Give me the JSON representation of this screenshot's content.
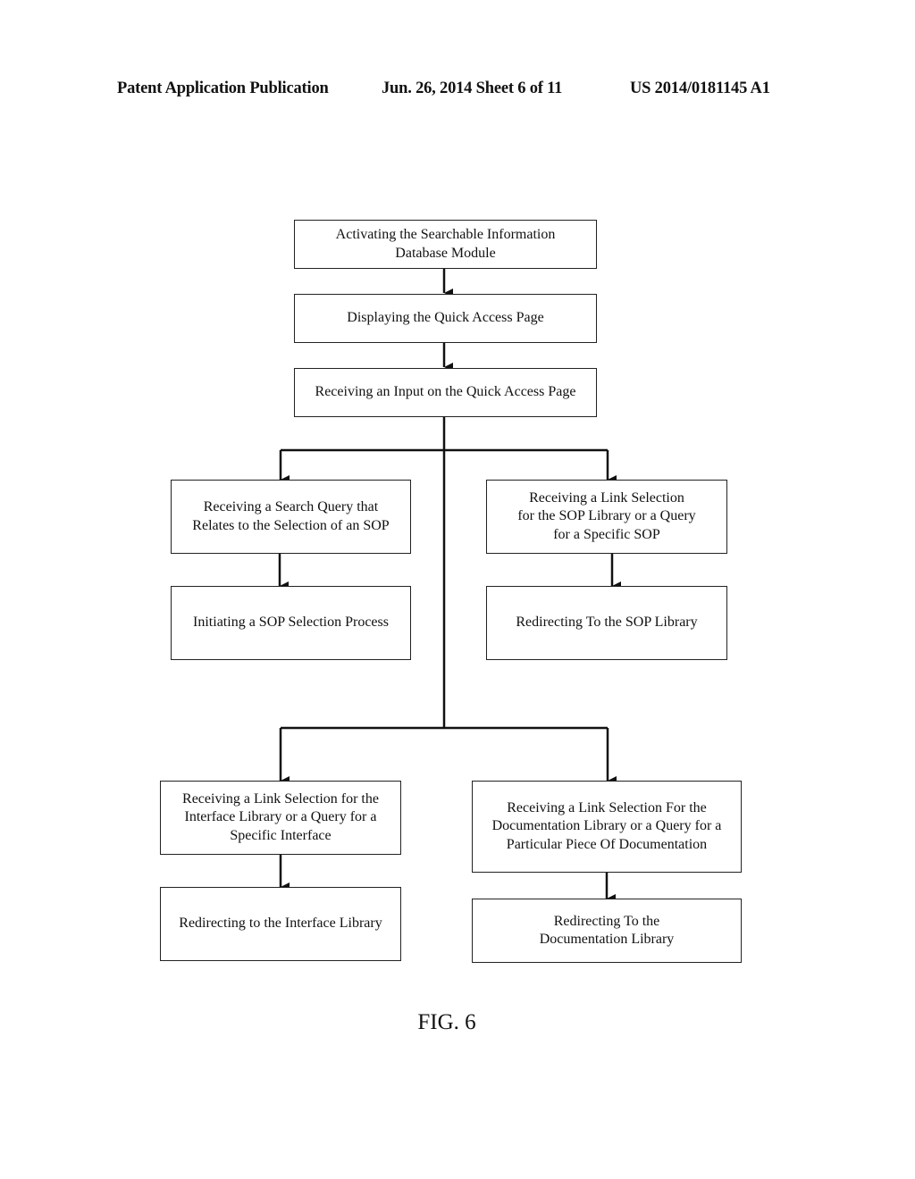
{
  "header": {
    "publication": "Patent Application Publication",
    "date_sheet": "Jun. 26, 2014  Sheet 6 of 11",
    "number": "US 2014/0181145 A1"
  },
  "flowchart": {
    "steps": {
      "activate": "Activating the Searchable Information\nDatabase Module",
      "display": "Displaying the Quick Access Page",
      "receive_input": "Receiving an Input on the Quick Access Page",
      "search_query": "Receiving a Search Query that\nRelates to the Selection of an SOP",
      "initiate_sop": "Initiating a SOP Selection Process",
      "sop_link": "Receiving a Link Selection\nfor the SOP Library or a Query\nfor a Specific SOP",
      "redirect_sop": "Redirecting To the SOP Library",
      "interface_link": "Receiving a Link Selection for the\nInterface Library or a Query for a\nSpecific Interface",
      "redirect_interface": "Redirecting to the Interface Library",
      "doc_link": "Receiving a Link Selection For the\nDocumentation Library or a Query for a\nParticular Piece Of Documentation",
      "redirect_doc": "Redirecting To the\nDocumentation Library"
    },
    "edges": [
      [
        "activate",
        "display"
      ],
      [
        "display",
        "receive_input"
      ],
      [
        "receive_input",
        "search_query"
      ],
      [
        "receive_input",
        "sop_link"
      ],
      [
        "receive_input",
        "interface_link"
      ],
      [
        "receive_input",
        "doc_link"
      ],
      [
        "search_query",
        "initiate_sop"
      ],
      [
        "sop_link",
        "redirect_sop"
      ],
      [
        "interface_link",
        "redirect_interface"
      ],
      [
        "doc_link",
        "redirect_doc"
      ]
    ]
  },
  "figure_label": "FIG. 6"
}
